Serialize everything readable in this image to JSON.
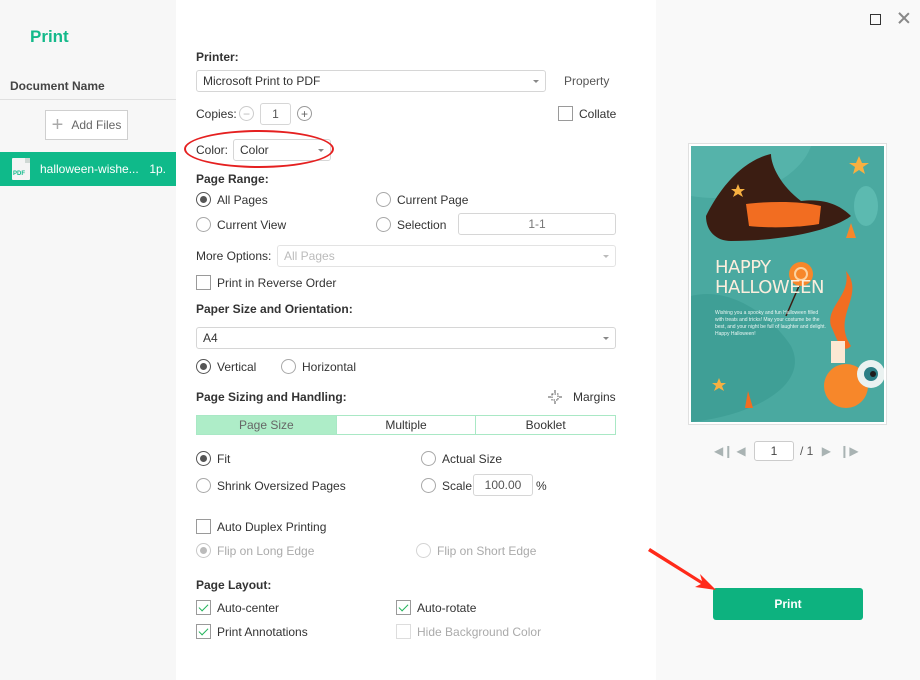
{
  "app": {
    "title": "Print"
  },
  "sidebar": {
    "doc_header": "Document Name",
    "add_files_label": "Add Files",
    "files": [
      {
        "icon": "pdf-icon",
        "icon_text": "PDF",
        "name": "halloween-wishe...",
        "pages": "1p."
      }
    ]
  },
  "printer": {
    "label": "Printer:",
    "selected": "Microsoft Print to PDF",
    "property_label": "Property",
    "copies_label": "Copies:",
    "copies_value": "1",
    "collate_label": "Collate",
    "collate_checked": false,
    "color_label": "Color:",
    "color_selected": "Color"
  },
  "page_range": {
    "label": "Page Range:",
    "options": [
      "All Pages",
      "Current Page",
      "Current View",
      "Selection"
    ],
    "selected": "All Pages",
    "selection_value": "1-1",
    "more_options_label": "More Options:",
    "more_options_selected": "All Pages",
    "reverse_order_label": "Print in Reverse Order",
    "reverse_order_checked": false
  },
  "paper": {
    "label": "Paper Size and Orientation:",
    "size_selected": "A4",
    "orientation_options": [
      "Vertical",
      "Horizontal"
    ],
    "orientation_selected": "Vertical"
  },
  "sizing": {
    "label": "Page Sizing and Handling:",
    "margins_label": "Margins",
    "tabs": [
      "Page Size",
      "Multiple",
      "Booklet"
    ],
    "active_tab": "Page Size",
    "options": [
      "Fit",
      "Actual Size",
      "Shrink Oversized Pages",
      "Scale"
    ],
    "selected": "Fit",
    "scale_value": "100.00",
    "scale_unit": "%",
    "duplex_label": "Auto Duplex Printing",
    "duplex_checked": false,
    "flip_options": [
      "Flip on Long Edge",
      "Flip on Short Edge"
    ],
    "flip_selected": "Flip on Long Edge"
  },
  "layout": {
    "label": "Page Layout:",
    "auto_center": {
      "label": "Auto-center",
      "checked": true
    },
    "auto_rotate": {
      "label": "Auto-rotate",
      "checked": true
    },
    "print_annotations": {
      "label": "Print Annotations",
      "checked": true
    },
    "hide_background": {
      "label": "Hide Background Color",
      "checked": false,
      "disabled": true
    }
  },
  "preview": {
    "heading_line1": "HAPPY",
    "heading_line2": "HALLOWEEN",
    "body": "Wishing you a spooky and fun Halloween filled with treats and tricks! May your costume be the best, and your night be full of laughter and delight. Happy Halloween!",
    "current_page": "1",
    "total_pages": "/ 1"
  },
  "actions": {
    "print_label": "Print"
  },
  "colors": {
    "accent": "#0db27f",
    "sidebar_selected": "#0fba8a",
    "annotation": "#e52020",
    "tab_active": "#aeedc8"
  }
}
